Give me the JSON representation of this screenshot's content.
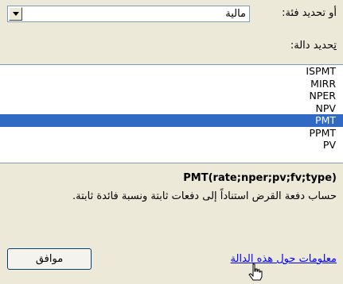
{
  "category": {
    "label": "أو تحديد فئة:",
    "value": "مالية"
  },
  "function_select": {
    "label_prefix": "ت",
    "label_rest": "حديد دالة:"
  },
  "functions": [
    "ISPMT",
    "MIRR",
    "NPER",
    "NPV",
    "PMT",
    "PPMT",
    "PV"
  ],
  "selected_function": "PMT",
  "syntax": "PMT(rate;nper;pv;fv;type)",
  "description": "حساب دفعة القرض استناداً إلى دفعات ثابتة ونسبة فائدة ثابتة.",
  "help_link": {
    "part1": "م",
    "part2": "علومات حول هذه الدالة"
  },
  "ok_button": "موافق",
  "colors": {
    "selection": "#316ac5",
    "link": "#0000ff",
    "background": "#ece9d8"
  }
}
